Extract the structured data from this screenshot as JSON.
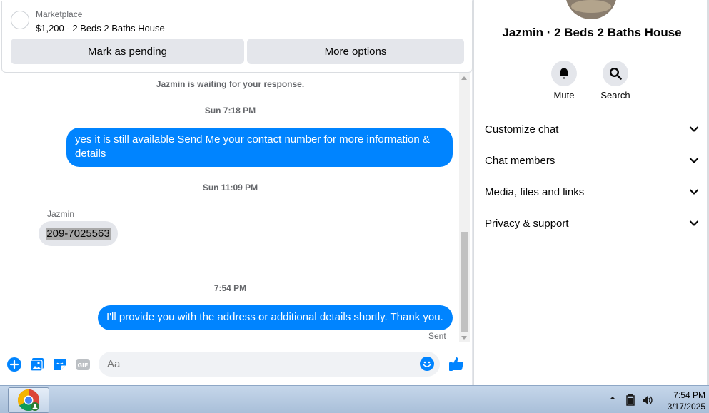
{
  "listing": {
    "source": "Marketplace",
    "title": "$1,200 - 2 Beds 2 Baths House",
    "mark_pending_label": "Mark as pending",
    "more_options_label": "More options"
  },
  "conversation": {
    "waiting_notice": "Jazmin is waiting for your response.",
    "timestamp_1": "Sun 7:18 PM",
    "outgoing_1": "yes it is still available Send Me your contact number for more information & details",
    "timestamp_2": "Sun 11:09 PM",
    "incoming_sender": "Jazmin",
    "incoming_1": "209-7025563",
    "timestamp_3": "7:54 PM",
    "outgoing_2": "I'll provide you with the address or additional details shortly. Thank you.",
    "delivery_status": "Sent"
  },
  "composer": {
    "placeholder": "Aa",
    "icons": [
      "plus-icon",
      "photo-icon",
      "sticker-icon",
      "gif-icon",
      "emoji-icon",
      "thumbs-up-icon"
    ],
    "gif_label": "GIF"
  },
  "info_panel": {
    "contact_title": "Jazmin · 2 Beds 2 Baths House",
    "mute_label": "Mute",
    "search_label": "Search",
    "sections": [
      {
        "label": "Customize chat"
      },
      {
        "label": "Chat members"
      },
      {
        "label": "Media, files and links"
      },
      {
        "label": "Privacy & support"
      }
    ]
  },
  "taskbar": {
    "time": "7:54 PM",
    "date": "3/17/2025"
  },
  "colors": {
    "accent": "#0084ff",
    "bubble_in": "#e4e6eb",
    "button_bg": "#e4e6eb"
  }
}
